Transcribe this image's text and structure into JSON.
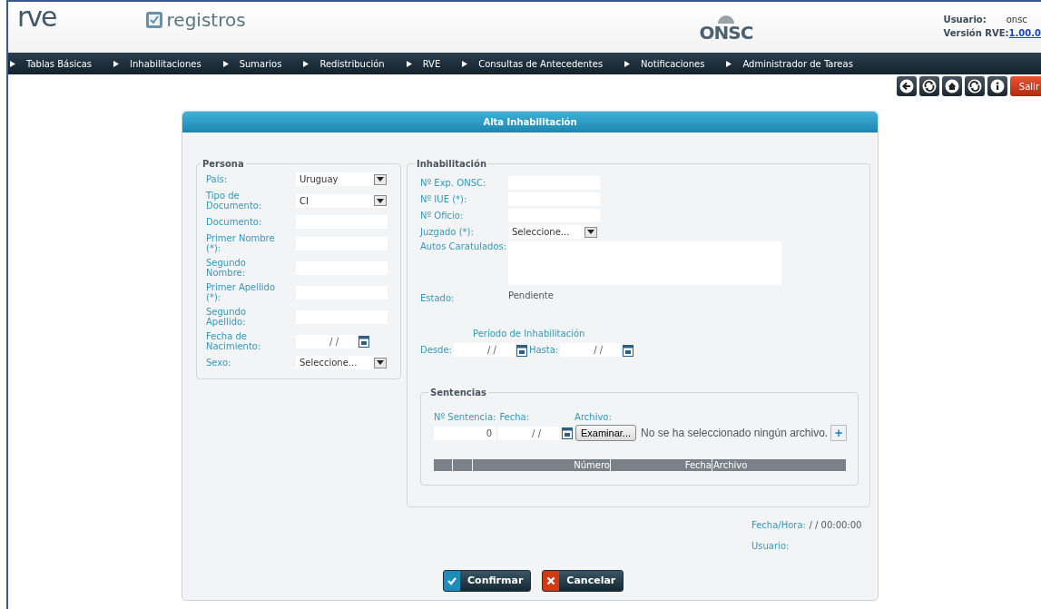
{
  "header": {
    "logo": "rve",
    "app_name": "registros",
    "org_logo": "ONSC",
    "user_label": "Usuario:",
    "user": "onsc",
    "version_label": "Versión RVE:",
    "version": "1.00.0"
  },
  "nav": [
    "Tablas Básicas",
    "Inhabilitaciones",
    "Sumarios",
    "Redistribución",
    "RVE",
    "Consultas de Antecedentes",
    "Notificaciones",
    "Administrador de Tareas"
  ],
  "toolbar": [
    {
      "kind": "back"
    },
    {
      "kind": "refresh"
    },
    {
      "kind": "home"
    },
    {
      "kind": "refresh"
    },
    {
      "kind": "info"
    },
    {
      "kind": "exit",
      "label": "Salir"
    }
  ],
  "form": {
    "title": "Alta Inhabilitación",
    "persona": {
      "legend": "Persona",
      "fields": [
        {
          "kind": "select",
          "label": "País:",
          "value": "Uruguay"
        },
        {
          "kind": "select",
          "label": "Tipo de Documento:",
          "value": "CI"
        },
        {
          "kind": "text",
          "label": "Documento:"
        },
        {
          "kind": "text",
          "label": "Primer Nombre (*):"
        },
        {
          "kind": "text",
          "label": "Segundo Nombre:"
        },
        {
          "kind": "text",
          "label": "Primer Apellido (*):"
        },
        {
          "kind": "text",
          "label": "Segundo Apellido:"
        },
        {
          "kind": "date",
          "label": "Fecha de Nacimiento:",
          "value": "/ /"
        },
        {
          "kind": "select",
          "label": "Sexo:",
          "value": "Seleccione..."
        }
      ]
    },
    "inhabilitacion": {
      "legend": "Inhabilitación",
      "fields": [
        {
          "kind": "text",
          "label": "Nº Exp. ONSC:"
        },
        {
          "kind": "text",
          "label": "Nº IUE (*):"
        },
        {
          "kind": "text",
          "label": "Nº Oficio:"
        },
        {
          "kind": "select",
          "label": "Juzgado (*):",
          "value": "Seleccione..."
        },
        {
          "kind": "textarea",
          "label": "Autos Caratulados:"
        },
        {
          "kind": "static",
          "label": "Estado:",
          "value": "Pendiente"
        }
      ],
      "period_title": "Período de Inhabilitación",
      "from_label": "Desde:",
      "from_value": "/ /",
      "to_label": "Hasta:",
      "to_value": "/ /"
    },
    "sentencias": {
      "legend": "Sentencias",
      "number_label": "Nº Sentencia:",
      "date_label": "Fecha:",
      "file_label": "Archivo:",
      "number_value": "0",
      "date_value": "/ /",
      "browse_button": "Examinar...",
      "file_status": "No se ha seleccionado ningún archivo.",
      "add_button": "+",
      "columns": [
        "Número",
        "Fecha",
        "Archivo"
      ]
    },
    "date_time_label": "Fecha/Hora:",
    "date_time_value": "/ / 00:00:00",
    "user_label": "Usuario:",
    "buttons": [
      {
        "kind": "confirm",
        "label": "Confirmar"
      },
      {
        "kind": "cancel",
        "label": "Cancelar"
      }
    ]
  }
}
